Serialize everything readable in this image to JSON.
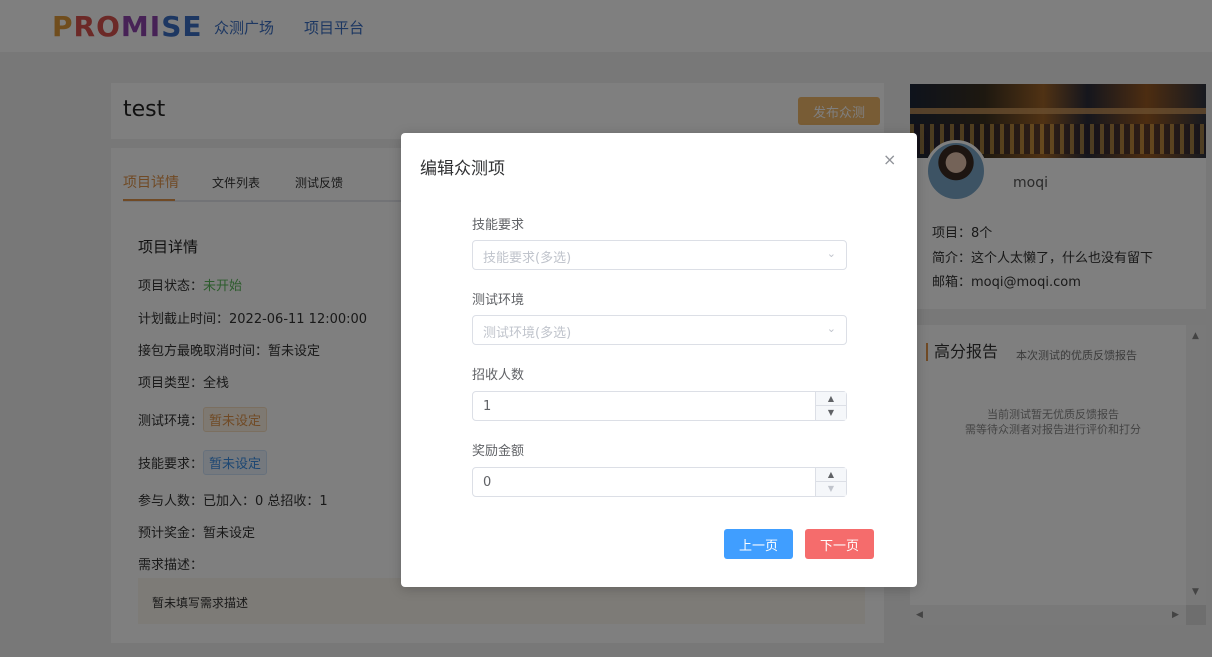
{
  "header": {
    "logo_parts": [
      "P",
      "RO",
      "MI",
      "SE"
    ],
    "nav": [
      "众测广场",
      "项目平台"
    ]
  },
  "project": {
    "title": "test",
    "publish_label": "发布众测",
    "tabs": [
      "项目详情",
      "文件列表",
      "测试反馈"
    ],
    "section_title": "项目详情",
    "status_label": "项目状态：",
    "status_value": "未开始",
    "deadline": "计划截止时间：2022-06-11 12:00:00",
    "cancel_time": "接包方最晚取消时间：暂未设定",
    "type": "项目类型：全栈",
    "env_label": "测试环境：",
    "env_value": "暂未设定",
    "skill_label": "技能要求：",
    "skill_value": "暂未设定",
    "participants": "参与人数：已加入：0    总招收：1",
    "reward": "预计奖金：暂未设定",
    "desc_label": "需求描述：",
    "desc_value": "暂未填写需求描述"
  },
  "profile": {
    "username": "moqi",
    "projects": "项目：8个",
    "bio": "简介：这个人太懒了，什么也没有留下",
    "email": "邮箱：moqi@moqi.com"
  },
  "report": {
    "title": "高分报告",
    "subtitle": "本次测试的优质反馈报告",
    "empty_line1": "当前测试暂无优质反馈报告",
    "empty_line2": "需等待众测者对报告进行评价和打分"
  },
  "modal": {
    "title": "编辑众测项",
    "close": "×",
    "fields": {
      "skill": {
        "label": "技能要求",
        "placeholder": "技能要求(多选)"
      },
      "env": {
        "label": "测试环境",
        "placeholder": "测试环境(多选)"
      },
      "recruit": {
        "label": "招收人数",
        "value": "1"
      },
      "reward": {
        "label": "奖励金额",
        "value": "0"
      }
    },
    "prev_label": "上一页",
    "next_label": "下一页"
  }
}
